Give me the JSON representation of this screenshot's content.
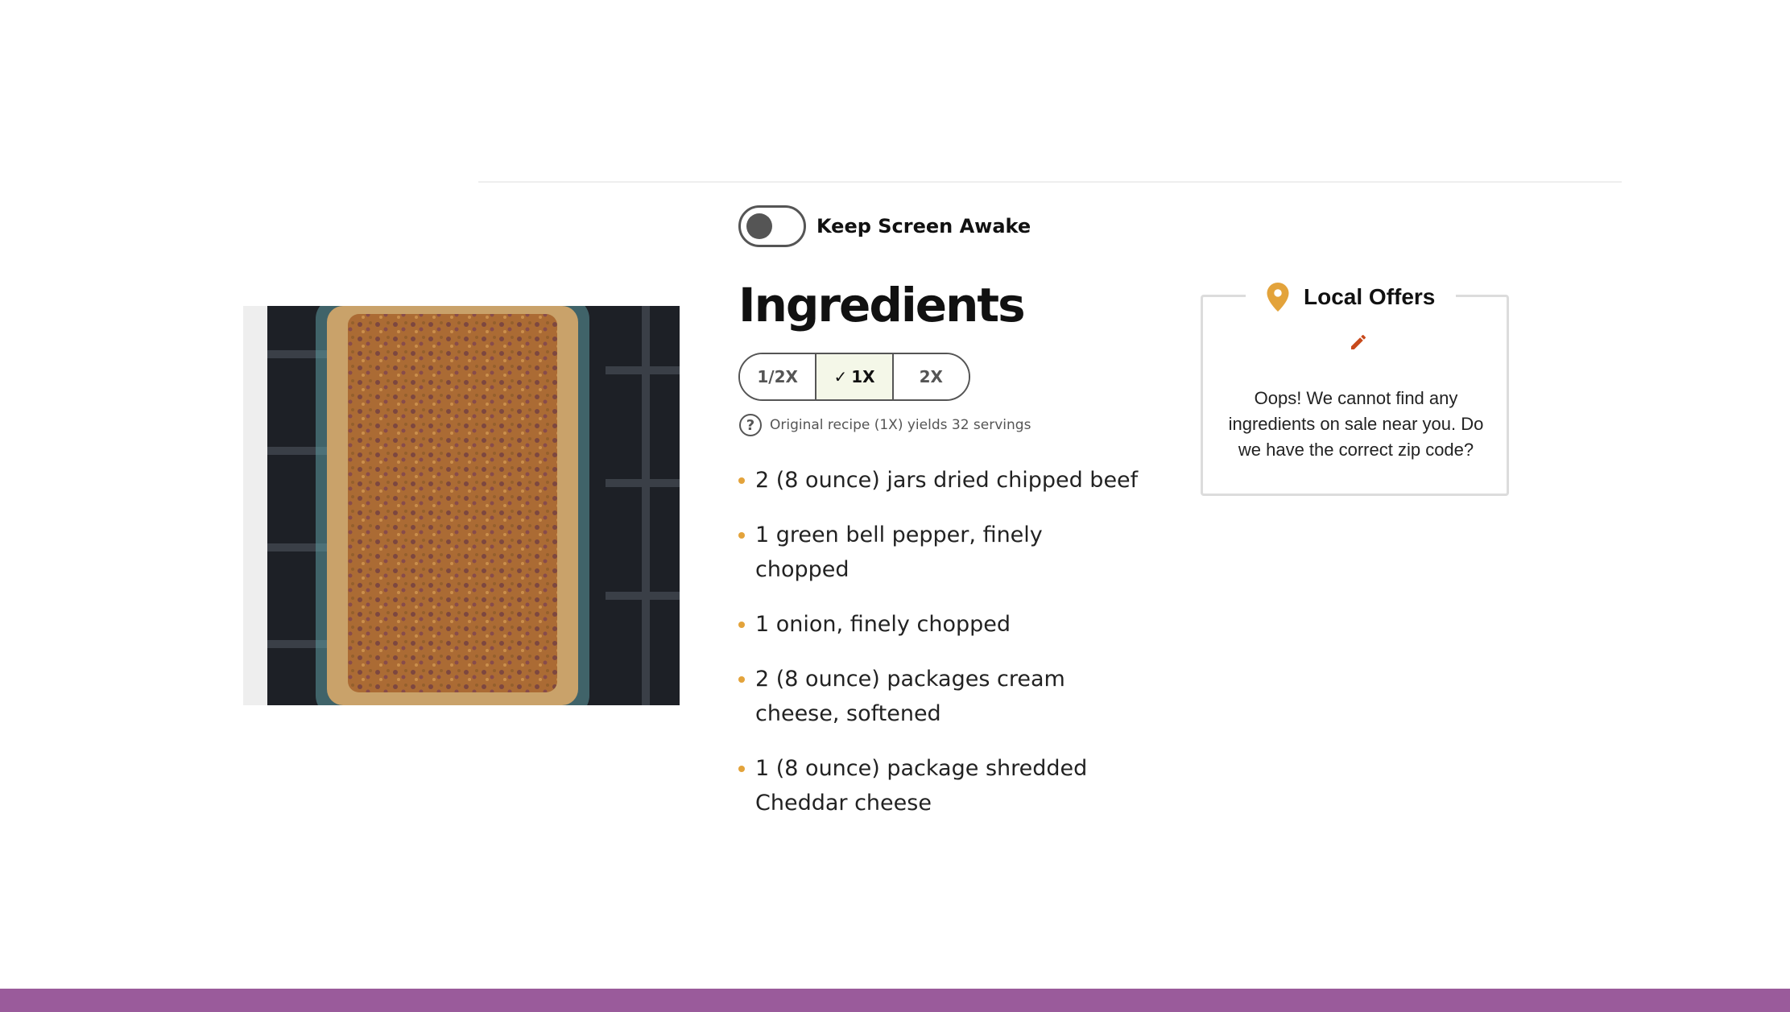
{
  "keep_awake": {
    "label": "Keep Screen Awake",
    "enabled": false
  },
  "ingredients": {
    "title": "Ingredients",
    "scale_options": [
      "1/2X",
      "1X",
      "2X"
    ],
    "scale_selected": "1X",
    "yield_note": "Original recipe (1X) yields 32 servings",
    "items": [
      "2 (8 ounce) jars dried chipped beef",
      "1 green bell pepper, finely chopped",
      "1 onion, finely chopped",
      "2 (8 ounce) packages cream cheese, softened",
      "1 (8 ounce) package shredded Cheddar cheese"
    ]
  },
  "local_offers": {
    "title": "Local Offers",
    "message": "Oops! We cannot find any ingredients on sale near you. Do we have the correct zip code?"
  },
  "icons": {
    "check": "check-icon",
    "help": "question-circle-icon",
    "location": "map-pin-icon",
    "edit": "pencil-icon"
  },
  "colors": {
    "bullet": "#e3a33b",
    "pin": "#e3a33b",
    "edit": "#c84a1c",
    "footer": "#9a5b9b",
    "active_scale_bg": "#f4f7e8"
  }
}
